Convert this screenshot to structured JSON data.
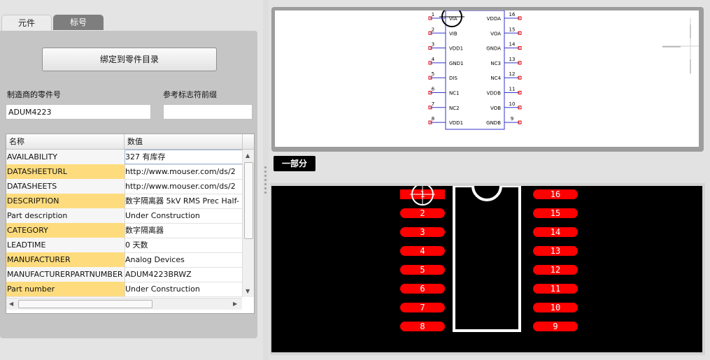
{
  "tabs": [
    {
      "label": "元件",
      "active": true
    },
    {
      "label": "标号",
      "active": false
    }
  ],
  "bind_button": "绑定到零件目录",
  "mfr_part_label": "制造商的零件号",
  "mfr_part_value": "ADUM4223",
  "ref_prefix_label": "参考标志符前缀",
  "ref_prefix_value": "",
  "grid": {
    "headers": [
      "名称",
      "数值"
    ],
    "rows": [
      {
        "name": "AVAILABILITY",
        "value": "327 有库存",
        "highlight": false
      },
      {
        "name": "DATASHEETURL",
        "value": "http://www.mouser.com/ds/2",
        "highlight": true
      },
      {
        "name": "DATASHEETS",
        "value": "http://www.mouser.com/ds/2",
        "highlight": false
      },
      {
        "name": "DESCRIPTION",
        "value": "数字隔离器 5kV RMS Prec Half-",
        "highlight": true
      },
      {
        "name": "Part description",
        "value": "Under Construction",
        "highlight": false
      },
      {
        "name": "CATEGORY",
        "value": "数字隔离器",
        "highlight": true
      },
      {
        "name": "LEADTIME",
        "value": "0 天数",
        "highlight": false
      },
      {
        "name": "MANUFACTURER",
        "value": "Analog Devices",
        "highlight": true
      },
      {
        "name": "MANUFACTURERPARTNUMBER",
        "value": "ADUM4223BRWZ",
        "highlight": false
      },
      {
        "name": "Part number",
        "value": "Under Construction",
        "highlight": true
      }
    ]
  },
  "section_label": "一部分",
  "schematic": {
    "left_pins": [
      {
        "num": "1",
        "name": "VIA"
      },
      {
        "num": "2",
        "name": "VIB"
      },
      {
        "num": "3",
        "name": "VDD1"
      },
      {
        "num": "4",
        "name": "GND1"
      },
      {
        "num": "5",
        "name": "DIS"
      },
      {
        "num": "6",
        "name": "NC1"
      },
      {
        "num": "7",
        "name": "NC2"
      },
      {
        "num": "8",
        "name": "VDD1"
      }
    ],
    "right_pins": [
      {
        "num": "16",
        "name": "VDDA"
      },
      {
        "num": "15",
        "name": "VOA"
      },
      {
        "num": "14",
        "name": "GNDA"
      },
      {
        "num": "13",
        "name": "NC3"
      },
      {
        "num": "12",
        "name": "NC4"
      },
      {
        "num": "11",
        "name": "VDDB"
      },
      {
        "num": "10",
        "name": "VOB"
      },
      {
        "num": "9",
        "name": "GNDB"
      }
    ]
  },
  "pcb": {
    "left_pads": [
      "1",
      "2",
      "3",
      "4",
      "5",
      "6",
      "7",
      "8"
    ],
    "right_pads": [
      "16",
      "15",
      "14",
      "13",
      "12",
      "11",
      "10",
      "9"
    ]
  },
  "colors": {
    "highlight_row": "#fedc7e",
    "pcb_background": "#000000",
    "pcb_pad": "#ff0000",
    "pin_line": "#3333cc",
    "pin_end": "#dd0000"
  }
}
